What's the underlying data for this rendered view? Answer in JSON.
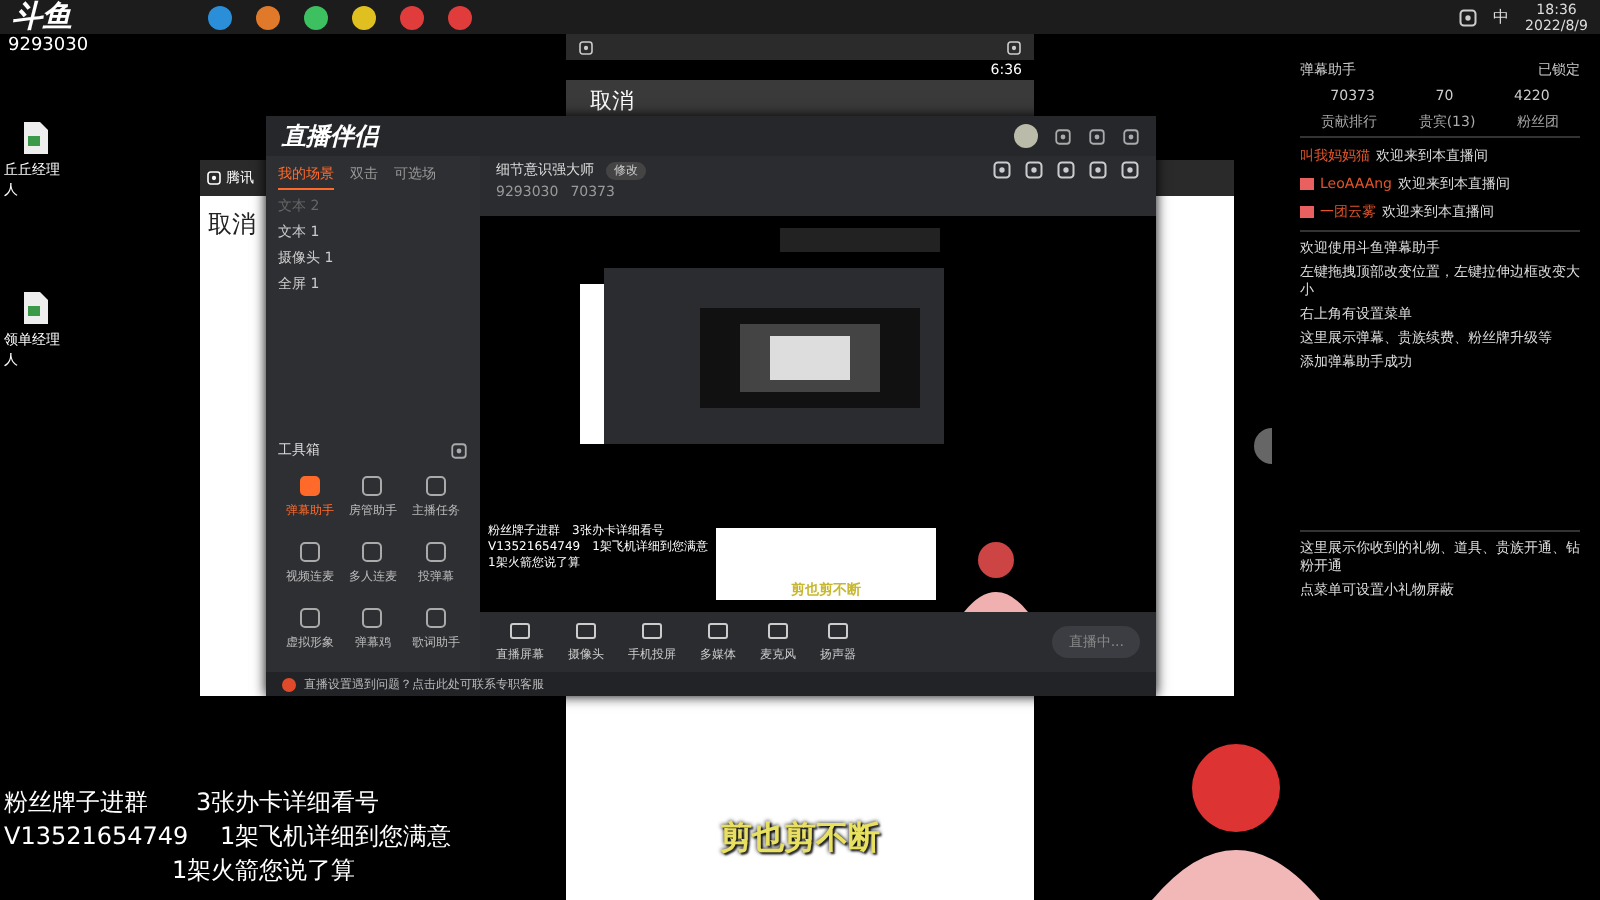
{
  "taskbar": {
    "logo": "斗鱼",
    "room_id": "9293030",
    "tray_lang": "中",
    "time": "18:36",
    "date": "2022/8/9"
  },
  "desktop_icons": [
    {
      "label": "丘丘经理人"
    },
    {
      "label": "领单经理人"
    }
  ],
  "phone_window": {
    "time": "6:36",
    "cancel": "取消"
  },
  "back_window": {
    "title": "腾讯",
    "cancel": "取消"
  },
  "app": {
    "logo": "直播伴侣",
    "tabs": [
      {
        "label": "我的场景",
        "selected": true
      },
      {
        "label": "双击",
        "selected": false
      },
      {
        "label": "可选场",
        "selected": false
      }
    ],
    "sources": [
      {
        "label": "文本 2",
        "visible": false
      },
      {
        "label": "文本 1",
        "visible": true
      },
      {
        "label": "摄像头 1",
        "visible": true
      },
      {
        "label": "全屏 1",
        "visible": true
      }
    ],
    "toolbox_title": "工具箱",
    "tools": [
      {
        "label": "弹幕助手",
        "active": true
      },
      {
        "label": "房管助手",
        "active": false
      },
      {
        "label": "主播任务",
        "active": false
      },
      {
        "label": "视频连麦",
        "active": false
      },
      {
        "label": "多人连麦",
        "active": false
      },
      {
        "label": "投弹幕",
        "active": false
      },
      {
        "label": "虚拟形象",
        "active": false
      },
      {
        "label": "弹幕鸡",
        "active": false
      },
      {
        "label": "歌词助手",
        "active": false
      }
    ],
    "room_title": "细节意识强大师",
    "edit_label": "修改",
    "room_id": "9293030",
    "popularity": "70373",
    "overlay_lines": [
      "粉丝牌子进群　3张办卡详细看号",
      "V13521654749　1架飞机详细到您满意",
      "1架火箭您说了算"
    ],
    "caption": "剪也剪不断",
    "controls": [
      {
        "label": "直播屏幕"
      },
      {
        "label": "摄像头"
      },
      {
        "label": "手机投屏"
      },
      {
        "label": "多媒体"
      },
      {
        "label": "麦克风"
      },
      {
        "label": "扬声器"
      }
    ],
    "live_button": "直播中...",
    "hint": "直播设置遇到问题？点击此处可联系专职客服"
  },
  "chat_panel": {
    "title": "弹幕助手",
    "lock_label": "已锁定",
    "stats": [
      "70373",
      "70",
      "4220"
    ],
    "tabs": [
      {
        "label": "贡献排行",
        "selected": false
      },
      {
        "label": "贵宾(13)",
        "selected": false
      },
      {
        "label": "粉丝团",
        "selected": false
      }
    ],
    "messages": [
      {
        "user": "叫我妈妈猫",
        "text": "欢迎来到本直播间",
        "badge": false
      },
      {
        "user": "LeoAAAng",
        "text": "欢迎来到本直播间",
        "badge": true
      },
      {
        "user": "一团云雾",
        "text": "欢迎来到本直播间",
        "badge": true
      }
    ],
    "notices": [
      "欢迎使用斗鱼弹幕助手",
      "左键拖拽顶部改变位置，左键拉伸边框改变大小",
      "右上角有设置菜单",
      "这里展示弹幕、贵族续费、粉丝牌升级等",
      "添加弹幕助手成功"
    ],
    "gift_notices": [
      "这里展示你收到的礼物、道具、贵族开通、钻粉开通",
      "点菜单可设置小礼物屏蔽"
    ]
  },
  "stream_overlay": {
    "lines": [
      "粉丝牌子进群　　3张办卡详细看号",
      "V13521654749　 1架飞机详细到您满意",
      "　　　　　　　1架火箭您说了算"
    ],
    "caption": "剪也剪不断"
  }
}
